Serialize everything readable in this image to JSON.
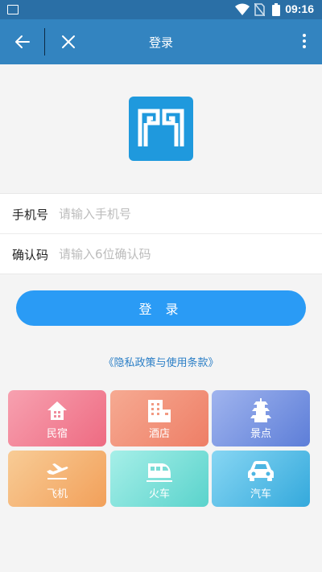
{
  "status_bar": {
    "time": "09:16"
  },
  "title_bar": {
    "title": "登录"
  },
  "form": {
    "phone_label": "手机号",
    "phone_placeholder": "请输入手机号",
    "code_label": "确认码",
    "code_placeholder": "请输入6位确认码"
  },
  "login_button_label": "登 录",
  "privacy_link": "《隐私政策与使用条款》",
  "categories": [
    {
      "label": "民宿",
      "icon": "house-icon"
    },
    {
      "label": "酒店",
      "icon": "building-icon"
    },
    {
      "label": "景点",
      "icon": "pagoda-icon"
    },
    {
      "label": "飞机",
      "icon": "airplane-icon"
    },
    {
      "label": "火车",
      "icon": "train-icon"
    },
    {
      "label": "汽车",
      "icon": "car-icon"
    }
  ],
  "colors": {
    "status_bar": "#2a6fa6",
    "title_bar": "#3384c0",
    "logo": "#1f99dd",
    "login_button": "#2a9bf5",
    "privacy_link": "#2a7ec6"
  }
}
